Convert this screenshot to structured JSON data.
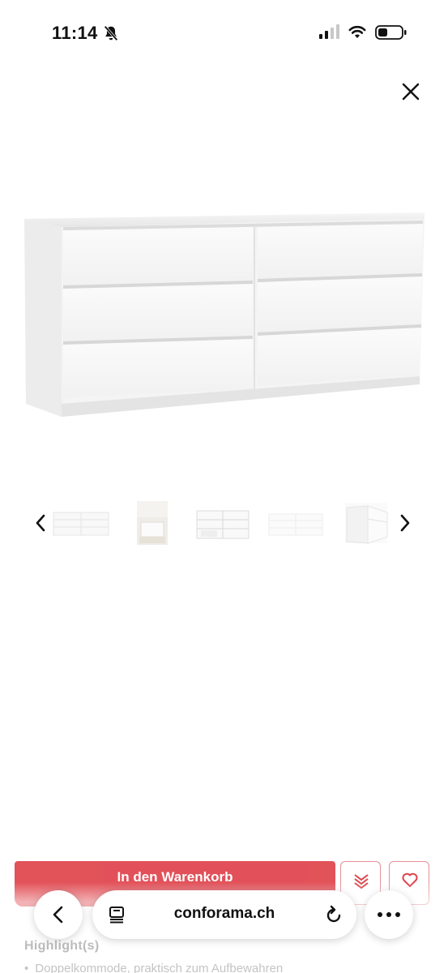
{
  "status_bar": {
    "time": "11:14",
    "icons": [
      "bell-slash-icon",
      "cellular-signal-icon",
      "wifi-icon",
      "battery-icon"
    ]
  },
  "gallery": {
    "close_icon": "close-icon",
    "main_image": "white-six-drawer-dresser",
    "thumbnails": [
      "dresser-front",
      "dresser-room-scene",
      "dresser-drawers-open",
      "dresser-front-light",
      "dresser-side-detail"
    ],
    "prev_icon": "chevron-left-icon",
    "next_icon": "chevron-right-icon"
  },
  "product_actions": {
    "cart_label": "In den Warenkorb",
    "compare_icon": "layers-icon",
    "wishlist_icon": "heart-icon"
  },
  "highlights": {
    "title": "Highlight(s)",
    "items": [
      "Doppelkommode, praktisch zum Aufbewahren"
    ]
  },
  "browser": {
    "url": "conforama.ch",
    "back_icon": "chevron-left-icon",
    "tabs_icon": "tabs-icon",
    "reload_icon": "reload-icon",
    "more_icon": "more-dots-icon"
  },
  "colors": {
    "accent": "#e0434b",
    "accent_border": "#e59097"
  }
}
